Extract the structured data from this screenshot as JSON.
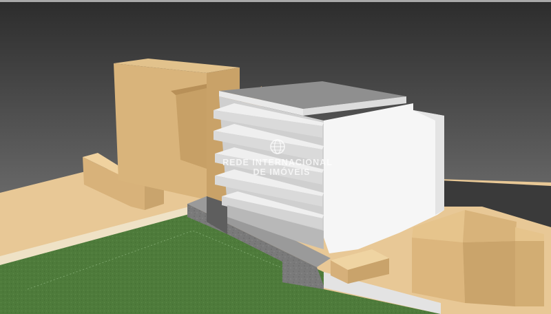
{
  "watermark": {
    "line1": "REDE INTERNACIONAL",
    "line2": "DE IMÓVEIS",
    "icon": "globe-icon"
  },
  "colors": {
    "sky_top": "#2f2f2f",
    "sky_bottom": "#8a8a8a",
    "ground_sand": "#e6c48f",
    "lawn": "#4f7d3c",
    "building_white": "#f4f4f4",
    "building_tan": "#d7b37a",
    "wall_gray": "#7b7b7b"
  }
}
